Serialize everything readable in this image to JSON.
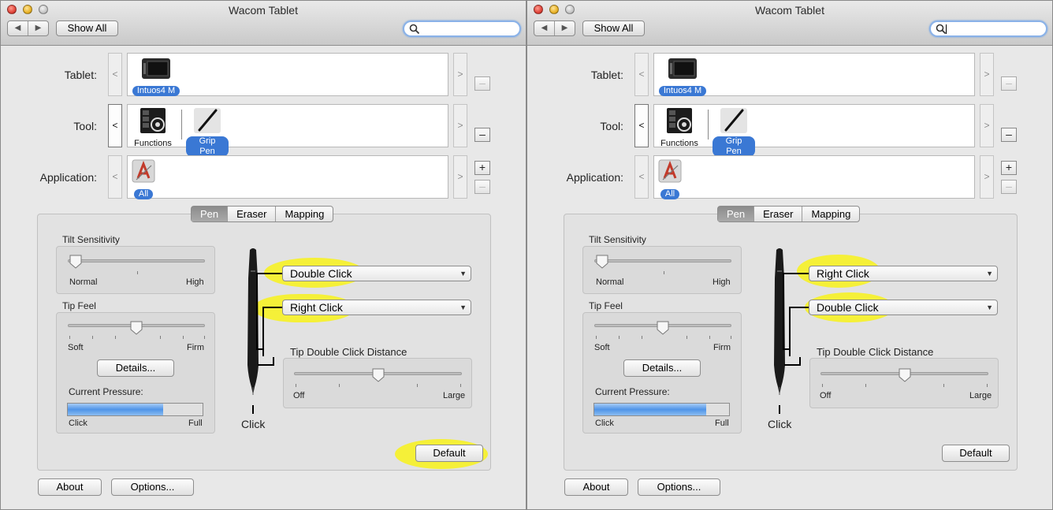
{
  "windows": [
    {
      "title": "Wacom Tablet",
      "toolbar": {
        "show_all": "Show All",
        "search_value": ""
      },
      "rows": {
        "tablet": {
          "label": "Tablet:",
          "item": "Intuos4 M"
        },
        "tool": {
          "label": "Tool:",
          "items": [
            "Functions",
            "Grip Pen"
          ]
        },
        "application": {
          "label": "Application:",
          "item": "All"
        }
      },
      "tabs": [
        "Pen",
        "Eraser",
        "Mapping"
      ],
      "selected_tab": "Pen",
      "tilt": {
        "label": "Tilt Sensitivity",
        "min": "Normal",
        "max": "High",
        "value": 0.0
      },
      "tip_feel": {
        "label": "Tip Feel",
        "min": "Soft",
        "max": "Firm",
        "value": 0.5
      },
      "details_button": "Details...",
      "pressure": {
        "label": "Current Pressure:",
        "min": "Click",
        "max": "Full",
        "value": 0.71
      },
      "pen_buttons": {
        "upper": "Double Click",
        "lower": "Right Click"
      },
      "pen_tip_label": "Click",
      "double_click_distance": {
        "label": "Tip Double Click Distance",
        "min": "Off",
        "max": "Large",
        "value": 0.5
      },
      "default_button": "Default",
      "about_button": "About",
      "options_button": "Options...",
      "highlight_color": "#f5f02e"
    },
    {
      "title": "Wacom Tablet",
      "toolbar": {
        "show_all": "Show All",
        "search_value": ""
      },
      "rows": {
        "tablet": {
          "label": "Tablet:",
          "item": "Intuos4 M"
        },
        "tool": {
          "label": "Tool:",
          "items": [
            "Functions",
            "Grip Pen"
          ]
        },
        "application": {
          "label": "Application:",
          "item": "All"
        }
      },
      "tabs": [
        "Pen",
        "Eraser",
        "Mapping"
      ],
      "selected_tab": "Pen",
      "tilt": {
        "label": "Tilt Sensitivity",
        "min": "Normal",
        "max": "High",
        "value": 0.0
      },
      "tip_feel": {
        "label": "Tip Feel",
        "min": "Soft",
        "max": "Firm",
        "value": 0.5
      },
      "details_button": "Details...",
      "pressure": {
        "label": "Current Pressure:",
        "min": "Click",
        "max": "Full",
        "value": 0.83
      },
      "pen_buttons": {
        "upper": "Right Click",
        "lower": "Double Click"
      },
      "pen_tip_label": "Click",
      "double_click_distance": {
        "label": "Tip Double Click Distance",
        "min": "Off",
        "max": "Large",
        "value": 0.5
      },
      "default_button": "Default",
      "about_button": "About",
      "options_button": "Options...",
      "highlight_color": "#f5f02e"
    }
  ]
}
